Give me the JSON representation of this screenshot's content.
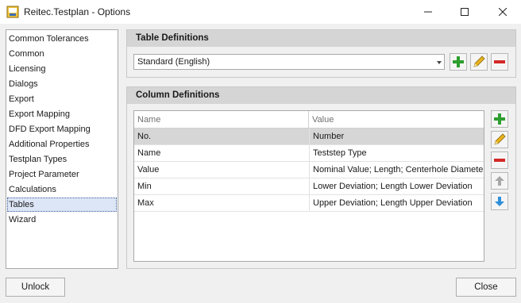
{
  "window": {
    "title": "Reitec.Testplan - Options",
    "icons": {
      "app": "app-icon",
      "minimize": "minimize-icon",
      "maximize": "maximize-icon",
      "close": "close-icon"
    }
  },
  "sidebar": {
    "items": [
      {
        "label": "Common Tolerances"
      },
      {
        "label": "Common"
      },
      {
        "label": "Licensing"
      },
      {
        "label": "Dialogs"
      },
      {
        "label": "Export"
      },
      {
        "label": "Export Mapping"
      },
      {
        "label": "DFD Export Mapping"
      },
      {
        "label": "Additional Properties"
      },
      {
        "label": "Testplan Types"
      },
      {
        "label": "Project Parameter"
      },
      {
        "label": "Calculations"
      },
      {
        "label": "Tables",
        "selected": true
      },
      {
        "label": "Wizard"
      }
    ]
  },
  "table_definitions": {
    "heading": "Table Definitions",
    "selected_value": "Standard (English)",
    "buttons": [
      "add-icon",
      "edit-icon",
      "remove-icon"
    ]
  },
  "column_definitions": {
    "heading": "Column Definitions",
    "columns": [
      "Name",
      "Value"
    ],
    "rows": [
      {
        "name": "No.",
        "value": "Number",
        "selected": true
      },
      {
        "name": "Name",
        "value": "Teststep Type"
      },
      {
        "name": "Value",
        "value": "Nominal Value; Length; Centerhole Diameter"
      },
      {
        "name": "Min",
        "value": "Lower Deviation; Length Lower Deviation"
      },
      {
        "name": "Max",
        "value": "Upper Deviation; Length Upper Deviation"
      }
    ],
    "buttons": [
      "add-icon",
      "edit-icon",
      "remove-icon",
      "arrow-up-icon",
      "arrow-down-icon"
    ]
  },
  "footer": {
    "unlock_label": "Unlock",
    "close_label": "Close"
  },
  "colors": {
    "add": "#2e9e2e",
    "remove": "#d42828",
    "edit": "#e8b21c",
    "arrow_down": "#2f8fd8",
    "arrow_up_disabled": "#a8a8a8",
    "selection": "#dde6f6"
  }
}
